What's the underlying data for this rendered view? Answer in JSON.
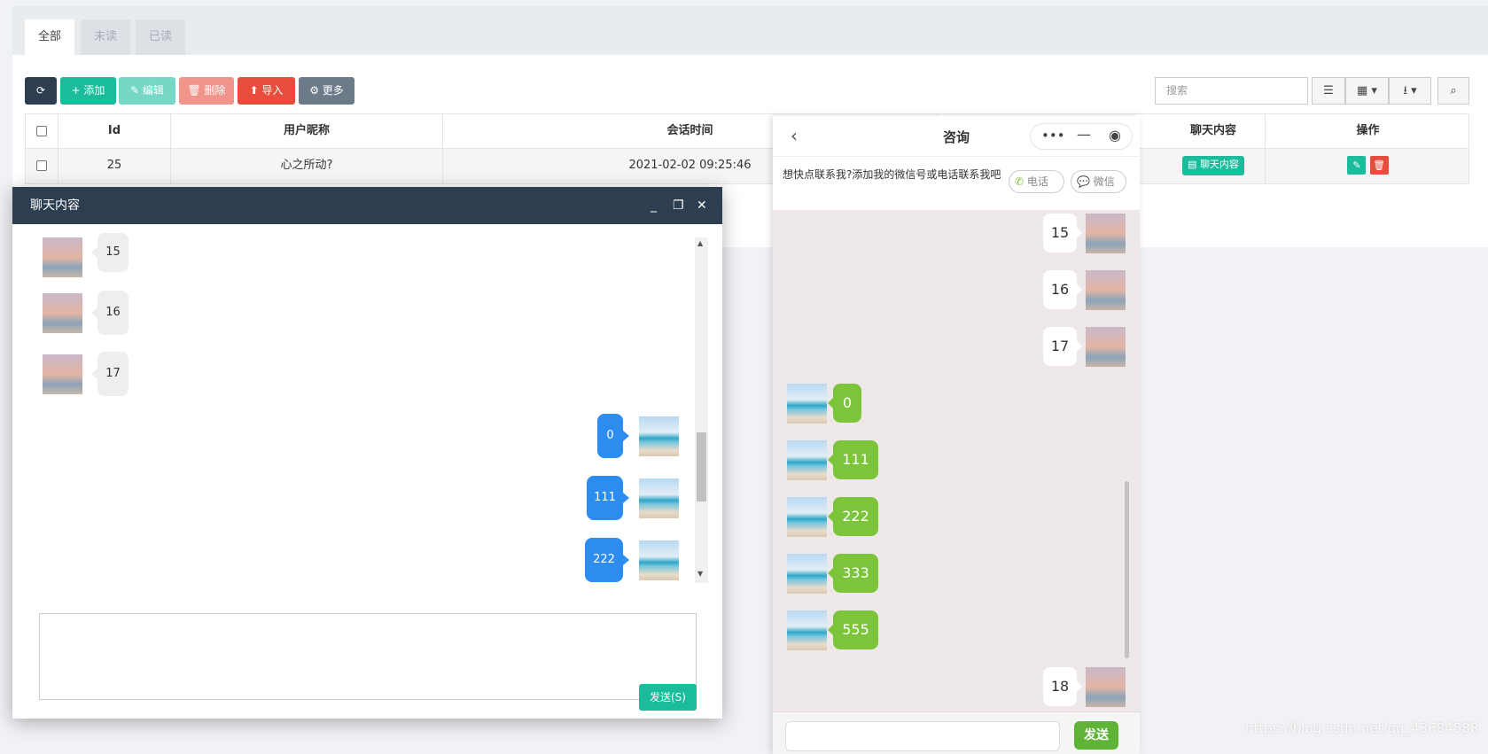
{
  "tabs": [
    "全部",
    "未读",
    "已读"
  ],
  "toolbar": {
    "refresh": "⟳",
    "add": "+ 添加",
    "edit": "✎ 编辑",
    "delete": "🗑 删除",
    "import": "⬆ 导入",
    "more": "⚙ 更多",
    "search_placeholder": "搜索"
  },
  "table": {
    "headers": [
      "Id",
      "用户昵称",
      "会话时间",
      "聊天内容",
      "操作"
    ],
    "row": {
      "id": "25",
      "nickname": "心之所动?",
      "time": "2021-02-02 09:25:46",
      "chat_button": "聊天内容"
    }
  },
  "popup": {
    "title": "聊天内容",
    "left_messages": [
      "15",
      "16",
      "17"
    ],
    "right_messages": [
      "0",
      "111",
      "222"
    ],
    "send_label": "发送(S)"
  },
  "mobile": {
    "title": "咨询",
    "notice": "想快点联系我?添加我的微信号或电话联系我吧",
    "phone_label": "电话",
    "wechat_label": "微信",
    "user_messages": [
      "15",
      "16",
      "17"
    ],
    "agent_messages": [
      "0",
      "111",
      "222",
      "333",
      "555"
    ],
    "last_message": "18",
    "send_label": "发送"
  },
  "watermark": "https://blog.csdn.net/qq_43684588",
  "colors": {
    "accent": "#1abc9c",
    "blue_bubble": "#2d8cf0",
    "green_bubble": "#7cc53a",
    "header_dark": "#2c3e50"
  }
}
